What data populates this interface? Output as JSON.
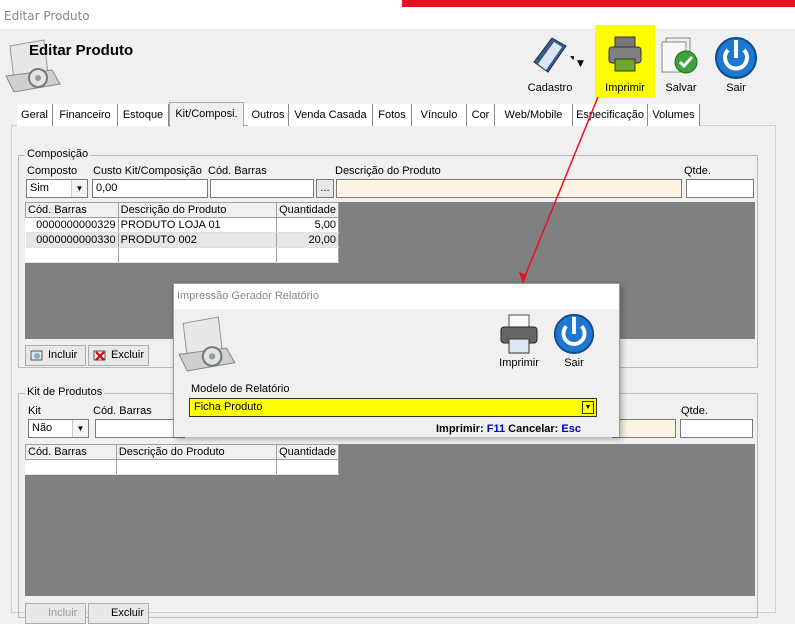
{
  "window": {
    "title": "Editar Produto"
  },
  "header": {
    "title": "Editar Produto"
  },
  "toolbar": {
    "cadastro": "Cadastro",
    "imprimir": "Imprimir",
    "salvar": "Salvar",
    "sair": "Sair"
  },
  "tabs": [
    "Geral",
    "Financeiro",
    "Estoque",
    "Kit/Composi.",
    "Outros",
    "Venda Casada",
    "Fotos",
    "Vínculo",
    "Cor",
    "Web/Mobile",
    "Especificação",
    "Volumes"
  ],
  "composicao": {
    "group_label": "Composição",
    "labels": {
      "composto": "Composto",
      "custo": "Custo Kit/Composição",
      "cod": "Cód. Barras",
      "desc": "Descrição do Produto",
      "qtde": "Qtde."
    },
    "composto_value": "Sim",
    "custo_value": "0,00",
    "browse_label": "...",
    "grid": {
      "headers": [
        "Cód. Barras",
        "Descrição do Produto",
        "Quantidade"
      ],
      "rows": [
        [
          "0000000000329",
          "PRODUTO LOJA 01",
          "5,00"
        ],
        [
          "0000000000330",
          "PRODUTO 002",
          "20,00"
        ]
      ]
    },
    "incluir": "Incluir",
    "excluir": "Excluir"
  },
  "kit": {
    "group_label": "Kit de Produtos",
    "labels": {
      "kit": "Kit",
      "cod": "Cód. Barras",
      "qtde": "Qtde."
    },
    "kit_value": "Não",
    "grid": {
      "headers": [
        "Cód. Barras",
        "Descrição do Produto",
        "Quantidade"
      ]
    },
    "incluir": "Incluir",
    "excluir": "Excluir"
  },
  "dialog": {
    "title": "Impressão Gerador Relatório",
    "imprimir": "Imprimir",
    "sair": "Sair",
    "modelo_label": "Modelo de Relatório",
    "modelo_value": "Ficha Produto",
    "hint_imprimir": "Imprimir:",
    "key_imprimir": "F11",
    "hint_cancelar": "Cancelar:",
    "key_cancelar": "Esc"
  },
  "colors": {
    "highlight": "#ffff00",
    "arrow": "#e81123",
    "grid_bg": "#808080",
    "cream": "#fdf5e1",
    "shortcut": "#0000cc"
  }
}
